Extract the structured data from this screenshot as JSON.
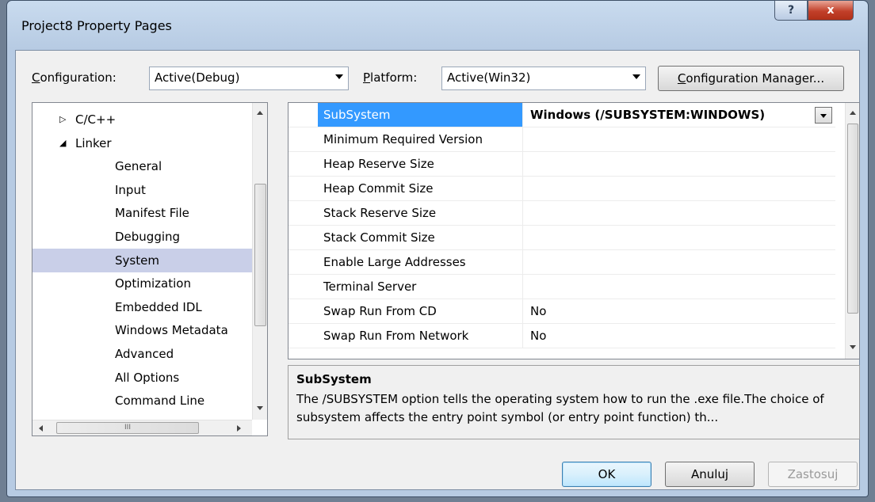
{
  "window": {
    "title": "Project8 Property Pages",
    "help_glyph": "?",
    "close_glyph": "x"
  },
  "config": {
    "configuration_label": "Configuration:",
    "configuration_value": "Active(Debug)",
    "platform_label": "Platform:",
    "platform_value": "Active(Win32)",
    "manager_button": "Configuration Manager..."
  },
  "tree": {
    "items": [
      {
        "label": "C/C++",
        "expander": "▷"
      },
      {
        "label": "Linker",
        "expander": "◢"
      },
      {
        "label": "General"
      },
      {
        "label": "Input"
      },
      {
        "label": "Manifest File"
      },
      {
        "label": "Debugging"
      },
      {
        "label": "System",
        "selected": true
      },
      {
        "label": "Optimization"
      },
      {
        "label": "Embedded IDL"
      },
      {
        "label": "Windows Metadata"
      },
      {
        "label": "Advanced"
      },
      {
        "label": "All Options"
      },
      {
        "label": "Command Line"
      }
    ],
    "hscroll_grip": "III"
  },
  "grid": {
    "rows": [
      {
        "name": "SubSystem",
        "value": "Windows (/SUBSYSTEM:WINDOWS)",
        "selected": true
      },
      {
        "name": "Minimum Required Version",
        "value": ""
      },
      {
        "name": "Heap Reserve Size",
        "value": ""
      },
      {
        "name": "Heap Commit Size",
        "value": ""
      },
      {
        "name": "Stack Reserve Size",
        "value": ""
      },
      {
        "name": "Stack Commit Size",
        "value": ""
      },
      {
        "name": "Enable Large Addresses",
        "value": ""
      },
      {
        "name": "Terminal Server",
        "value": ""
      },
      {
        "name": "Swap Run From CD",
        "value": "No"
      },
      {
        "name": "Swap Run From Network",
        "value": "No"
      }
    ]
  },
  "description": {
    "title": "SubSystem",
    "text": "The /SUBSYSTEM option tells the operating system how to run the .exe file.The choice of subsystem affects the entry point symbol (or entry point function) th..."
  },
  "buttons": {
    "ok": "OK",
    "cancel": "Anuluj",
    "apply": "Zastosuj"
  }
}
